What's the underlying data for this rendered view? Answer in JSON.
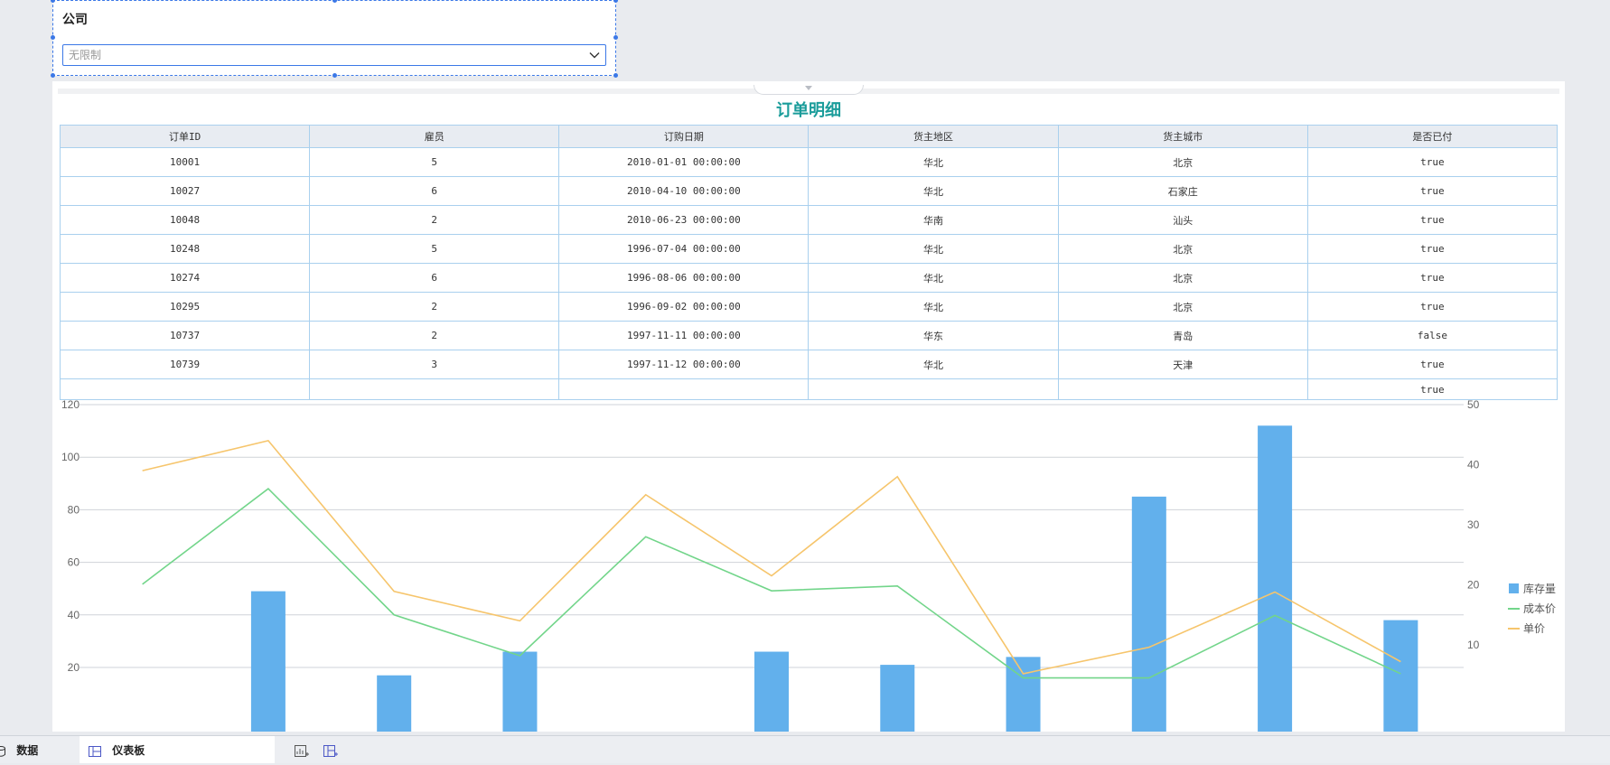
{
  "filter": {
    "title": "公司",
    "placeholder": "无限制"
  },
  "table": {
    "title": "订单明细",
    "columns": [
      "订单ID",
      "雇员",
      "订购日期",
      "货主地区",
      "货主城市",
      "是否已付"
    ],
    "rows": [
      [
        "10001",
        "5",
        "2010-01-01 00:00:00",
        "华北",
        "北京",
        "true"
      ],
      [
        "10027",
        "6",
        "2010-04-10 00:00:00",
        "华北",
        "石家庄",
        "true"
      ],
      [
        "10048",
        "2",
        "2010-06-23 00:00:00",
        "华南",
        "汕头",
        "true"
      ],
      [
        "10248",
        "5",
        "1996-07-04 00:00:00",
        "华北",
        "北京",
        "true"
      ],
      [
        "10274",
        "6",
        "1996-08-06 00:00:00",
        "华北",
        "北京",
        "true"
      ],
      [
        "10295",
        "2",
        "1996-09-02 00:00:00",
        "华北",
        "北京",
        "true"
      ],
      [
        "10737",
        "2",
        "1997-11-11 00:00:00",
        "华东",
        "青岛",
        "false"
      ],
      [
        "10739",
        "3",
        "1997-11-12 00:00:00",
        "华北",
        "天津",
        "true"
      ],
      [
        "",
        "",
        "",
        "",
        "",
        "true"
      ]
    ]
  },
  "chart_data": {
    "type": "bar",
    "y_left": {
      "ticks": [
        20,
        40,
        60,
        80,
        100,
        120
      ],
      "range": [
        0,
        120
      ]
    },
    "y_right": {
      "ticks": [
        10,
        20,
        30,
        40,
        50
      ],
      "range": [
        0,
        50
      ]
    },
    "categories_count": 11,
    "grid": true,
    "legend_position": "right",
    "series": [
      {
        "name": "库存量",
        "kind": "bar",
        "axis": "left",
        "color": "#62b0ec",
        "values": [
          null,
          49,
          17,
          26,
          null,
          26,
          21,
          24,
          85,
          112,
          38
        ]
      },
      {
        "name": "成本价",
        "kind": "line",
        "axis": "right",
        "color": "#72d58a",
        "values": [
          20.1,
          36,
          15,
          8.2,
          28,
          19,
          19.8,
          4.5,
          4.5,
          14.9,
          5.2
        ]
      },
      {
        "name": "单价",
        "kind": "line",
        "axis": "right",
        "color": "#f6c56c",
        "values": [
          39,
          44,
          18.9,
          14,
          35,
          21.5,
          38,
          5.2,
          9.6,
          18.8,
          7.2
        ]
      }
    ]
  },
  "bottom_tabs": {
    "data_label": "数据",
    "dashboard_label": "仪表板"
  },
  "icons": {
    "dropdown": "chevron-down-icon",
    "data_tab": "database-icon",
    "dashboard_tab": "dashboard-icon",
    "tools": [
      "add-chart-icon",
      "add-dashboard-icon"
    ]
  },
  "colors": {
    "accent": "#3b78e7",
    "title": "#1a9c9a",
    "table_border": "#a9d0ee"
  }
}
